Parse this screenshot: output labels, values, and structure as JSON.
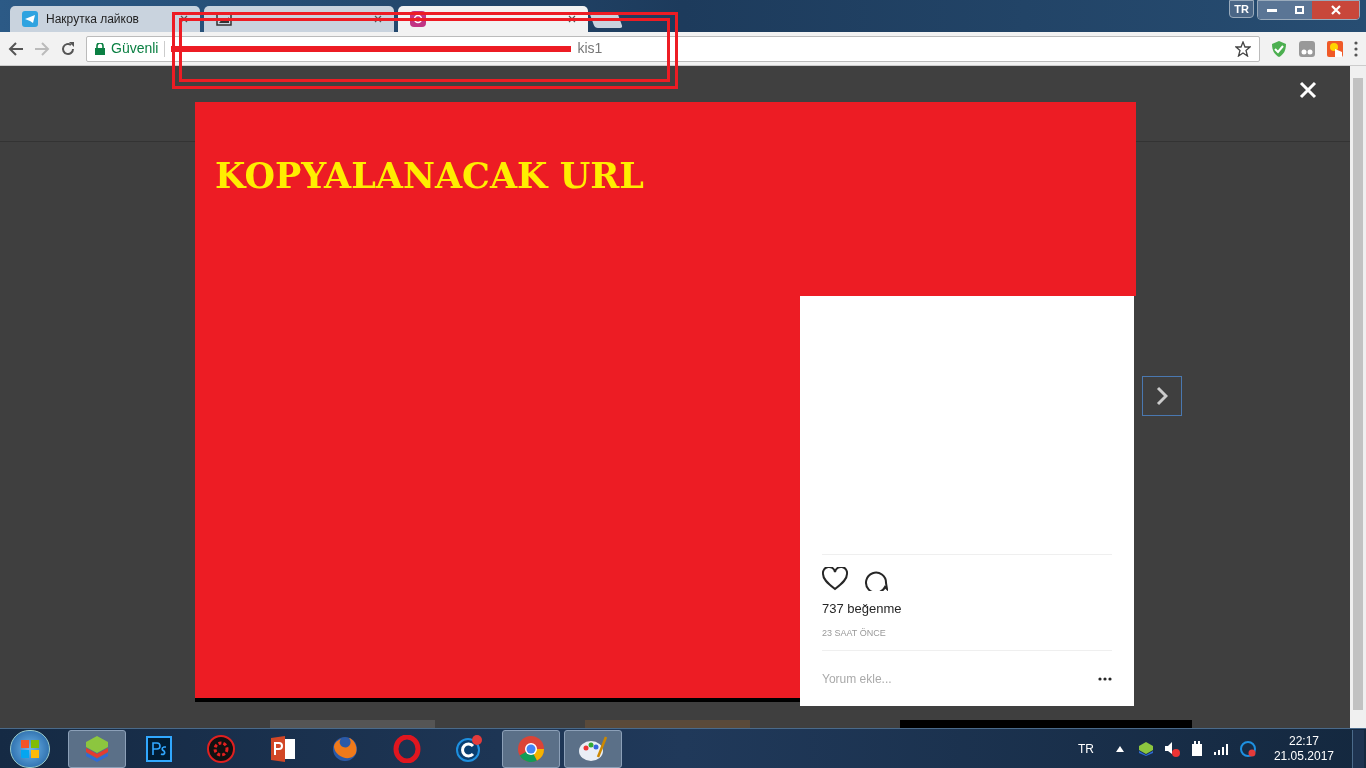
{
  "browser": {
    "tabs": [
      {
        "title": "Накрутка лайков",
        "selected": false,
        "kind": "telegram"
      },
      {
        "selected": false,
        "kind": "page"
      },
      {
        "selected": true,
        "kind": "instagram"
      }
    ],
    "window_language": "TR",
    "address": {
      "secure_label": "Güvenli",
      "url_tail": "kis1"
    }
  },
  "annotation": {
    "heading": "KOPYALANACAK URL"
  },
  "post": {
    "liked": false,
    "likes": "737 beğenme",
    "time": "23 SAAT ÖNCE",
    "comment_placeholder": "Yorum ekle..."
  },
  "taskbar": {
    "apps": [
      {
        "kind": "bluestacks",
        "active": true
      },
      {
        "kind": "photoshop",
        "active": false
      },
      {
        "kind": "driver",
        "active": false
      },
      {
        "kind": "powerpoint",
        "active": false
      },
      {
        "kind": "firefox",
        "active": false
      },
      {
        "kind": "opera",
        "active": false
      },
      {
        "kind": "cleaner",
        "active": false
      },
      {
        "kind": "chrome",
        "active": true
      },
      {
        "kind": "paint",
        "active": true
      }
    ],
    "language": "TR",
    "time": "22:17",
    "date": "21.05.2017"
  }
}
